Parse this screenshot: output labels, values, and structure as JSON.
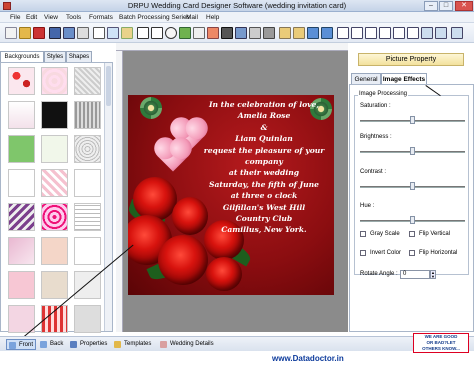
{
  "window": {
    "title": "DRPU Wedding Card Designer Software (wedding invitation card)",
    "min": "–",
    "max": "□",
    "close": "✕"
  },
  "menu": [
    "File",
    "Edit",
    "View",
    "Tools",
    "Formats",
    "Batch Processing Series",
    "Mail",
    "Help"
  ],
  "left_panel": {
    "tabs": [
      "Backgrounds",
      "Styles",
      "Shapes"
    ],
    "active_tab": "Backgrounds"
  },
  "card": {
    "lines": [
      "In the celebration of love,",
      "Amelia Rose",
      "&",
      "Liam Quinlan",
      "request the pleasure of your",
      "company",
      "at their wedding",
      "Saturday, the fifth of June",
      "at three o clock",
      "Gilfillan's West Hill",
      "Country Club",
      "Camillus, New York."
    ]
  },
  "right_panel": {
    "header": "Picture Property",
    "tabs": [
      "General",
      "Image Effects"
    ],
    "active_tab": "Image Effects",
    "group_title": "Image Processing",
    "sliders": [
      {
        "label": "Saturation :",
        "value": 0.5
      },
      {
        "label": "Brightness :",
        "value": 0.5
      },
      {
        "label": "Contrast :",
        "value": 0.5
      },
      {
        "label": "Hue :",
        "value": 0.5
      }
    ],
    "checkboxes": [
      "Gray Scale",
      "Flip Vertical",
      "Invert Color",
      "Flip Horizontal"
    ],
    "rotate_label": "Rotate Angle :",
    "rotate_value": "0"
  },
  "bottom_tabs": [
    "Front",
    "Back",
    "Properties",
    "Templates",
    "Wedding Details"
  ],
  "active_bottom_tab": "Front",
  "footer": {
    "url": "www.Datadoctor.in",
    "badge": [
      "WE ARE GOOD",
      "OR BAD?LET",
      "OTHERS KNOW..."
    ]
  }
}
